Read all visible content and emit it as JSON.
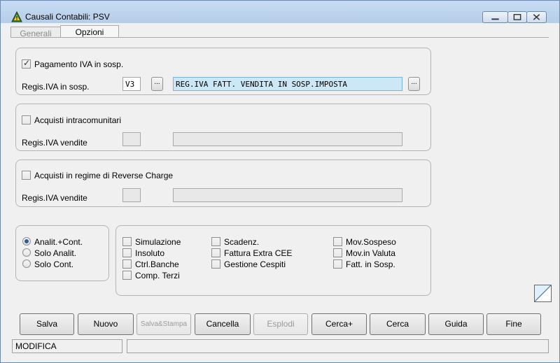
{
  "window": {
    "title": "Causali Contabili: PSV",
    "icon": "warning-triangle-icon"
  },
  "tabs": [
    {
      "label": "Generali",
      "active": false
    },
    {
      "label": "Opzioni",
      "active": true
    }
  ],
  "section1": {
    "checkbox_label": "Pagamento IVA in sosp.",
    "checked": true,
    "field_label": "Regis.IVA in sosp.",
    "code_value": "V3",
    "desc_value": "REG.IVA FATT. VENDITA IN SOSP.IMPOSTA",
    "lookup_label": "..."
  },
  "section2": {
    "checkbox_label": "Acquisti intracomunitari",
    "checked": false,
    "field_label": "Regis.IVA vendite",
    "code_value": "",
    "desc_value": ""
  },
  "section3": {
    "checkbox_label": "Acquisti in regime di Reverse Charge",
    "checked": false,
    "field_label": "Regis.IVA vendite",
    "code_value": "",
    "desc_value": ""
  },
  "radio_group": {
    "options": [
      {
        "label": "Analit.+Cont.",
        "selected": true
      },
      {
        "label": "Solo Analit.",
        "selected": false
      },
      {
        "label": "Solo Cont.",
        "selected": false
      }
    ]
  },
  "options_group": {
    "col1": [
      {
        "label": "Simulazione",
        "checked": false
      },
      {
        "label": "Insoluto",
        "checked": false
      },
      {
        "label": "Ctrl.Banche",
        "checked": false
      },
      {
        "label": "Comp. Terzi",
        "checked": false
      }
    ],
    "col2": [
      {
        "label": "Scadenz.",
        "checked": false
      },
      {
        "label": "Fattura Extra CEE",
        "checked": false
      },
      {
        "label": "Gestione Cespiti",
        "checked": false
      }
    ],
    "col3": [
      {
        "label": "Mov.Sospeso",
        "checked": false
      },
      {
        "label": "Mov.in Valuta",
        "checked": false
      },
      {
        "label": "Fatt. in Sosp.",
        "checked": false
      }
    ]
  },
  "toolbar": {
    "salva": "Salva",
    "nuovo": "Nuovo",
    "salva_stampa": "Salva&Stampa",
    "cancella": "Cancella",
    "esplodi": "Esplodi",
    "cerca_plus": "Cerca+",
    "cerca": "Cerca",
    "guida": "Guida",
    "fine": "Fine"
  },
  "status": {
    "mode": "MODIFICA",
    "message": ""
  },
  "colors": {
    "titlebar": "#c7dcf3",
    "highlight_field": "#cce8f6"
  }
}
